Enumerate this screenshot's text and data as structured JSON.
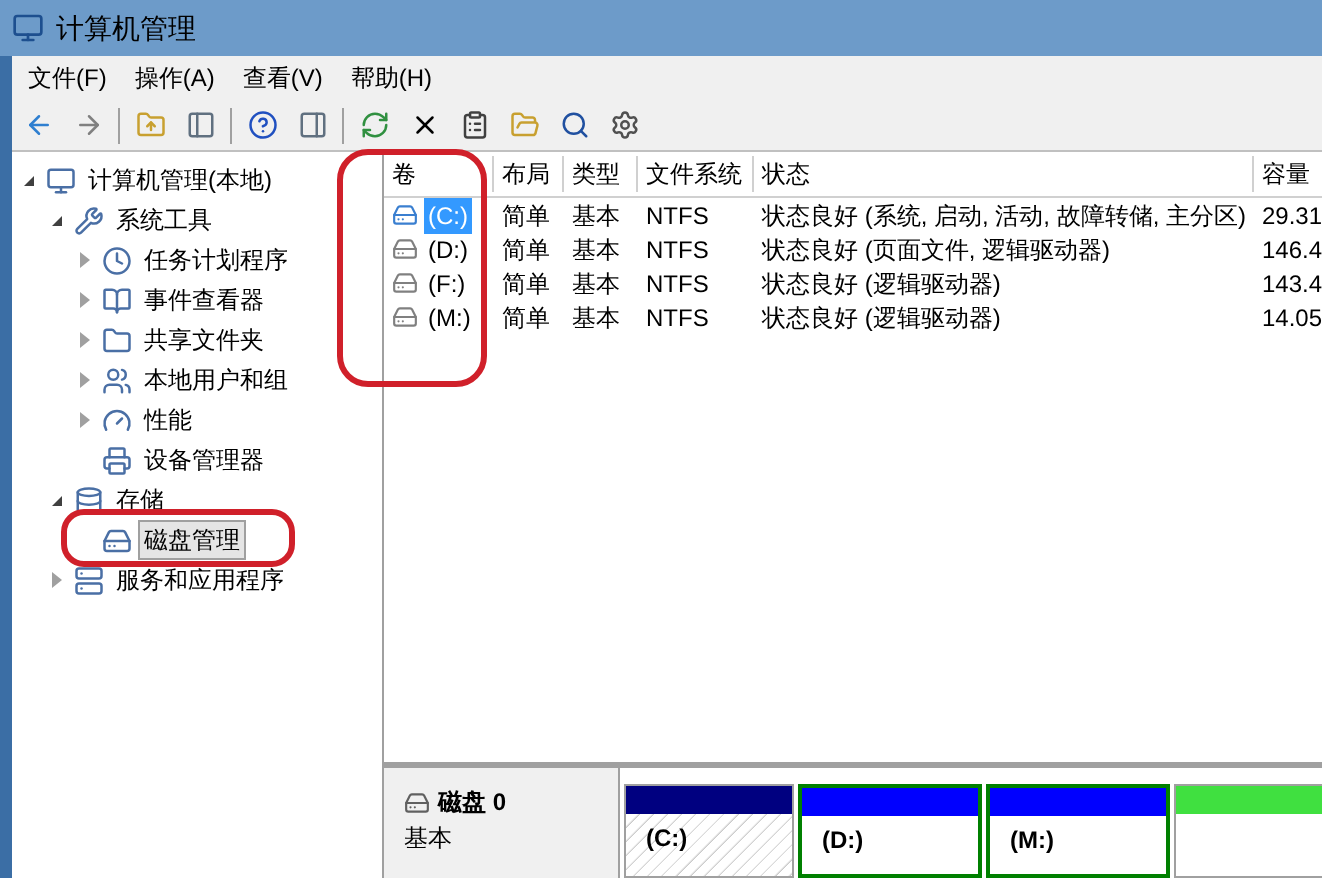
{
  "window": {
    "title": "计算机管理"
  },
  "menu": [
    "文件(F)",
    "操作(A)",
    "查看(V)",
    "帮助(H)"
  ],
  "tree": [
    {
      "label": "计算机管理(本地)",
      "expanded": true,
      "selected": false,
      "children": [
        {
          "label": "系统工具",
          "expanded": true,
          "selected": false,
          "children": [
            {
              "label": "任务计划程序",
              "expanded": false,
              "selected": false
            },
            {
              "label": "事件查看器",
              "expanded": false,
              "selected": false
            },
            {
              "label": "共享文件夹",
              "expanded": false,
              "selected": false
            },
            {
              "label": "本地用户和组",
              "expanded": false,
              "selected": false
            },
            {
              "label": "性能",
              "expanded": false,
              "selected": false
            },
            {
              "label": "设备管理器",
              "selected": false
            }
          ]
        },
        {
          "label": "存储",
          "expanded": true,
          "selected": false,
          "children": [
            {
              "label": "磁盘管理",
              "selected": true
            }
          ]
        },
        {
          "label": "服务和应用程序",
          "expanded": false,
          "selected": false
        }
      ]
    }
  ],
  "table": {
    "columns": [
      "卷",
      "布局",
      "类型",
      "文件系统",
      "状态",
      "容量"
    ],
    "rows": [
      {
        "selected": true,
        "cells": [
          "(C:)",
          "简单",
          "基本",
          "NTFS",
          "状态良好 (系统, 启动, 活动, 故障转储, 主分区)",
          "29.31"
        ]
      },
      {
        "selected": false,
        "cells": [
          "(D:)",
          "简单",
          "基本",
          "NTFS",
          "状态良好 (页面文件, 逻辑驱动器)",
          "146.4"
        ]
      },
      {
        "selected": false,
        "cells": [
          "(F:)",
          "简单",
          "基本",
          "NTFS",
          "状态良好 (逻辑驱动器)",
          "143.4"
        ]
      },
      {
        "selected": false,
        "cells": [
          "(M:)",
          "简单",
          "基本",
          "NTFS",
          "状态良好 (逻辑驱动器)",
          "14.05"
        ]
      }
    ]
  },
  "disk": {
    "name": "磁盘 0",
    "type": "基本",
    "partitions": [
      {
        "kind": "primary",
        "label": "(C:)",
        "selected": true
      },
      {
        "kind": "logical",
        "label": "(D:)",
        "selected": false
      },
      {
        "kind": "logical",
        "label": "(M:)",
        "selected": false
      },
      {
        "kind": "free",
        "selected": false
      }
    ]
  }
}
